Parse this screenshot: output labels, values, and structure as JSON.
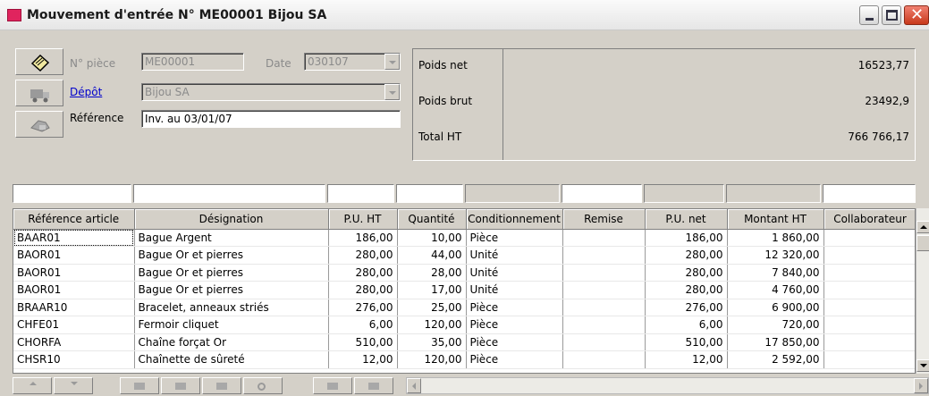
{
  "window": {
    "title": "Mouvement d'entrée N° ME00001 Bijou SA"
  },
  "header": {
    "piece_label": "N° pièce",
    "piece_value": "ME00001",
    "date_label": "Date",
    "date_value": "030107",
    "depot_label": "Dépôt",
    "depot_value": "Bijou SA",
    "reference_label": "Référence",
    "reference_value": "Inv. au 03/01/07"
  },
  "stats": {
    "poids_net_label": "Poids net",
    "poids_net_value": "16523,77",
    "poids_brut_label": "Poids brut",
    "poids_brut_value": "23492,9",
    "total_ht_label": "Total HT",
    "total_ht_value": "766 766,17"
  },
  "grid": {
    "columns": [
      "Référence article",
      "Désignation",
      "P.U. HT",
      "Quantité",
      "Conditionnement",
      "Remise",
      "P.U. net",
      "Montant HT",
      "Collaborateur"
    ],
    "rows": [
      [
        "BAAR01",
        "Bague Argent",
        "186,00",
        "10,00",
        "Pièce",
        "",
        "186,00",
        "1 860,00",
        ""
      ],
      [
        "BAOR01",
        "Bague Or et pierres",
        "280,00",
        "44,00",
        "Unité",
        "",
        "280,00",
        "12 320,00",
        ""
      ],
      [
        "BAOR01",
        "Bague Or et pierres",
        "280,00",
        "28,00",
        "Unité",
        "",
        "280,00",
        "7 840,00",
        ""
      ],
      [
        "BAOR01",
        "Bague Or et pierres",
        "280,00",
        "17,00",
        "Unité",
        "",
        "280,00",
        "4 760,00",
        ""
      ],
      [
        "BRAAR10",
        "Bracelet, anneaux striés",
        "276,00",
        "25,00",
        "Pièce",
        "",
        "276,00",
        "6 900,00",
        ""
      ],
      [
        "CHFE01",
        "Fermoir cliquet",
        "6,00",
        "120,00",
        "Pièce",
        "",
        "6,00",
        "720,00",
        ""
      ],
      [
        "CHORFA",
        "Chaîne forçat Or",
        "510,00",
        "35,00",
        "Pièce",
        "",
        "510,00",
        "17 850,00",
        ""
      ],
      [
        "CHSR10",
        "Chaînette de sûreté",
        "12,00",
        "120,00",
        "Pièce",
        "",
        "12,00",
        "2 592,00",
        ""
      ]
    ]
  },
  "colors": {
    "window_bg": "#d4d0c8",
    "title_icon": "#e0245e",
    "close_button": "#c8391c",
    "link": "#0000cc"
  },
  "icons": [
    "document-icon",
    "truck-icon",
    "transfer-icon",
    "scroll-up-icon",
    "scroll-down-icon",
    "scroll-left-icon",
    "scroll-right-icon"
  ]
}
